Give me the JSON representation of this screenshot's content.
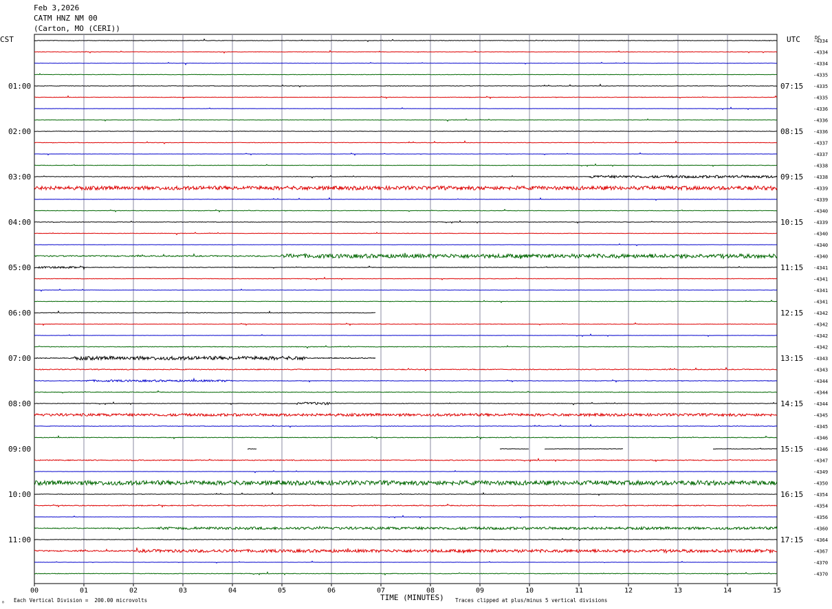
{
  "header": {
    "date": "Feb 3,2026",
    "station": "CATM HNZ NM 00",
    "location": "(Carton, MO (CERI))"
  },
  "left_zone_label": "CST",
  "right_zone_label": "UTC",
  "dc_label": "DC",
  "x_axis_title": "TIME (MINUTES)",
  "scale_note": "Each Vertical Division =  200.00 microvolts",
  "clip_note": "Traces clipped at plus/minus 5 vertical divisions",
  "corner_mark": "⁰",
  "colors": {
    "cycle": [
      "#000000",
      "#dd0000",
      "#0000cc",
      "#006600"
    ],
    "grid": "#8a8aa0"
  },
  "chart_data": {
    "type": "line",
    "title": "",
    "xlabel": "TIME (MINUTES)",
    "xlim": [
      0,
      15
    ],
    "x_tick_labels": [
      "00",
      "01",
      "02",
      "03",
      "04",
      "05",
      "06",
      "07",
      "08",
      "09",
      "10",
      "11",
      "12",
      "13",
      "14",
      "15"
    ],
    "trace_minutes": 15,
    "trace_count": 48,
    "left_hour_labels": [
      "01:00",
      "02:00",
      "03:00",
      "04:00",
      "05:00",
      "06:00",
      "07:00",
      "08:00",
      "09:00",
      "10:00",
      "11:00"
    ],
    "right_hour_labels": [
      "07:15",
      "08:15",
      "09:15",
      "10:15",
      "11:15",
      "12:15",
      "13:15",
      "14:15",
      "15:15",
      "16:15",
      "17:15"
    ],
    "dc_offsets": [
      "-4334",
      "-4334",
      "-4334",
      "-4335",
      "-4335",
      "-4335",
      "-4336",
      "-4336",
      "-4336",
      "-4337",
      "-4337",
      "-4338",
      "-4338",
      "-4339",
      "-4339",
      "-4340",
      "-4339",
      "-4340",
      "-4340",
      "-4340",
      "-4341",
      "-4341",
      "-4341",
      "-4341",
      "-4342",
      "-4342",
      "-4342",
      "-4342",
      "-4343",
      "-4343",
      "-4344",
      "-4344",
      "-4344",
      "-4345",
      "-4345",
      "-4346",
      "-4346",
      "-4347",
      "-4349",
      "-4350",
      "-4354",
      "-4354",
      "-4356",
      "-4360",
      "-4364",
      "-4367",
      "-4370",
      "-4370"
    ],
    "noise_level": [
      1,
      1,
      0.5,
      1,
      1,
      1,
      0.5,
      1,
      1,
      1,
      0.5,
      1,
      1,
      4,
      0.5,
      1,
      1,
      1,
      0.5,
      3,
      1,
      1,
      0.5,
      1,
      1,
      1,
      0.5,
      1.5,
      2,
      2,
      1,
      1.5,
      1,
      3,
      1,
      1.5,
      1,
      2,
      0.5,
      4,
      1,
      2,
      0.5,
      2,
      1,
      3,
      0.5,
      1.5
    ],
    "bursts": [
      {
        "trace": 12,
        "from": 11.2,
        "to": 15.0,
        "amplitude": 3
      },
      {
        "trace": 13,
        "from": 0.0,
        "to": 15.0,
        "amplitude": 3
      },
      {
        "trace": 19,
        "from": 5.0,
        "to": 15.0,
        "amplitude": 4
      },
      {
        "trace": 20,
        "from": 0.0,
        "to": 1.0,
        "amplitude": 2
      },
      {
        "trace": 28,
        "from": 0.8,
        "to": 5.5,
        "amplitude": 4
      },
      {
        "trace": 30,
        "from": 1.0,
        "to": 4.0,
        "amplitude": 2
      },
      {
        "trace": 32,
        "from": 5.3,
        "to": 6.0,
        "amplitude": 3
      },
      {
        "trace": 33,
        "from": 0.0,
        "to": 15.0,
        "amplitude": 2
      },
      {
        "trace": 39,
        "from": 0.0,
        "to": 15.0,
        "amplitude": 4
      },
      {
        "trace": 43,
        "from": 2.5,
        "to": 15.0,
        "amplitude": 2.5
      },
      {
        "trace": 45,
        "from": 2.0,
        "to": 15.0,
        "amplitude": 2.5
      }
    ],
    "gaps": [
      {
        "trace": 24,
        "from": 6.9,
        "to": 15.0
      },
      {
        "trace": 28,
        "from": 6.9,
        "to": 15.0
      },
      {
        "trace": 36,
        "from": 0.0,
        "to": 4.3
      },
      {
        "trace": 36,
        "from": 4.5,
        "to": 9.4
      },
      {
        "trace": 36,
        "from": 10.0,
        "to": 10.3
      },
      {
        "trace": 36,
        "from": 11.9,
        "to": 13.7
      }
    ]
  }
}
